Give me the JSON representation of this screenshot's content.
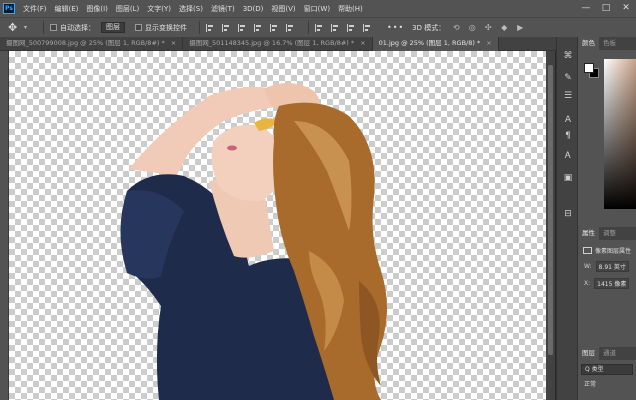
{
  "menubar": {
    "logo": "Ps",
    "items": [
      "文件(F)",
      "编辑(E)",
      "图像(I)",
      "图层(L)",
      "文字(Y)",
      "选择(S)",
      "滤镜(T)",
      "3D(D)",
      "视图(V)",
      "窗口(W)",
      "帮助(H)"
    ],
    "window_controls": [
      "—",
      "□",
      "✕"
    ]
  },
  "options": {
    "auto_select_label": "自动选择：",
    "auto_select_value": "图层",
    "show_transform_label": "显示变换控件",
    "more": "•••",
    "mode_3d_label": "3D 模式："
  },
  "tabs": [
    {
      "label": "摄图网_500799008.jpg @ 25% (图层 1, RGB/8#) *",
      "close": "×",
      "active": false
    },
    {
      "label": "摄图网_501148345.jpg @ 16.7% (图层 1, RGB/8#) *",
      "close": "×",
      "active": false
    },
    {
      "label": "01.jpg @ 25% (图层 1, RGB/8) *",
      "close": "×",
      "active": true
    }
  ],
  "panels": {
    "color_tabs": [
      "颜色",
      "色板"
    ],
    "properties_tabs": [
      "属性",
      "调整"
    ],
    "pixel_layer_label": "像素图层属性",
    "w_label": "W:",
    "w_value": "8.91 英寸",
    "x_label": "X:",
    "x_value": "1415 像素",
    "layers_tabs": [
      "图层",
      "通道"
    ],
    "filter_value": "Q 类型",
    "blend_mode": "正常"
  },
  "colors": {
    "accent": "#31a8ff",
    "dress": "#1f2b4a",
    "hair": "#a86b2c",
    "skin": "#f0c9b4"
  }
}
